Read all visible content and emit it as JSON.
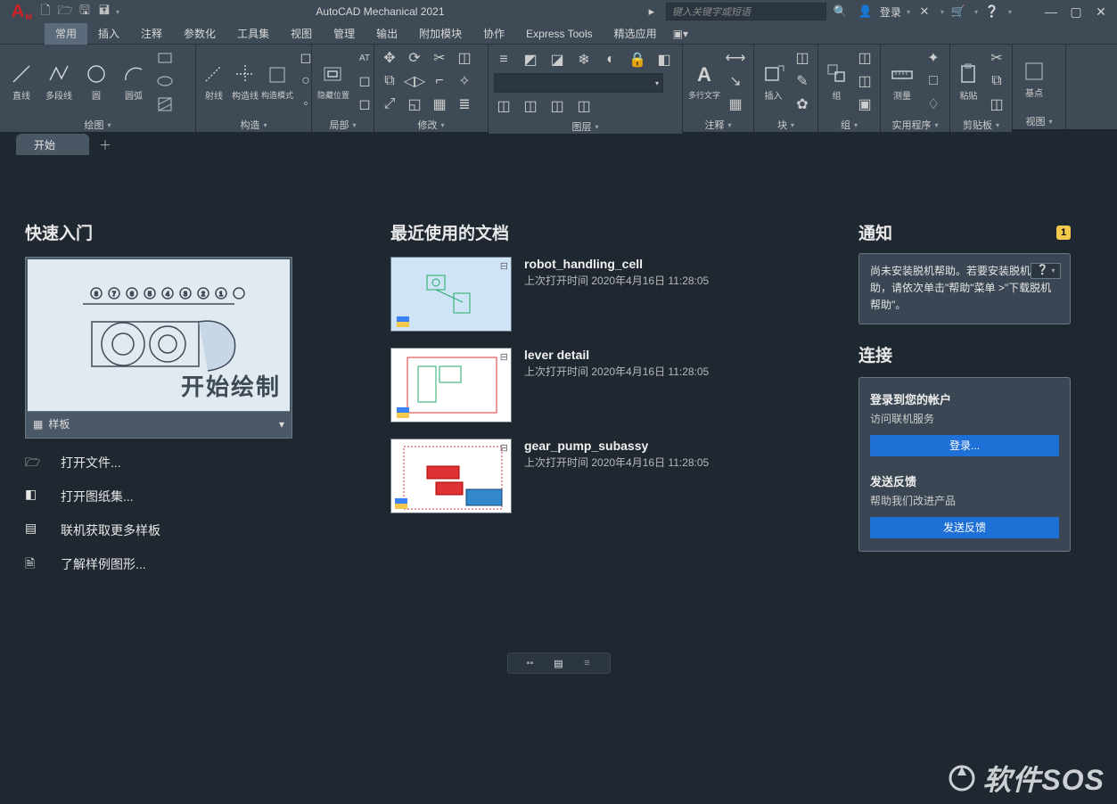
{
  "app": {
    "title": "AutoCAD Mechanical 2021",
    "logo": "A",
    "logo_sub": "M"
  },
  "search": {
    "placeholder": "键入关键字或短语",
    "login": "登录"
  },
  "ribbon_tabs": [
    "常用",
    "插入",
    "注释",
    "参数化",
    "工具集",
    "视图",
    "管理",
    "输出",
    "附加模块",
    "协作",
    "Express Tools",
    "精选应用"
  ],
  "panels": {
    "draw": {
      "title": "绘图",
      "tools": [
        "直线",
        "多段线",
        "圆",
        "圆弧"
      ]
    },
    "construct": {
      "title": "构造",
      "tools": [
        "射线",
        "构造线",
        "构造模式"
      ]
    },
    "visibility": {
      "title": "局部",
      "tool": "隐藏位置"
    },
    "modify": {
      "title": "修改"
    },
    "layer": {
      "title": "图层"
    },
    "text": {
      "title": "注释",
      "tool": "多行文字"
    },
    "block": {
      "title": "块",
      "tool": "插入"
    },
    "group": {
      "title": "组",
      "tool": "组"
    },
    "util": {
      "title": "实用程序",
      "tool": "测量"
    },
    "clip": {
      "title": "剪贴板",
      "tool": "粘贴"
    },
    "view": {
      "title": "视图",
      "tool": "基点"
    }
  },
  "doc_tab": "开始",
  "quickstart": {
    "title": "快速入门",
    "overlay": "开始绘制",
    "template": "样板",
    "links": [
      "打开文件...",
      "打开图纸集...",
      "联机获取更多样板",
      "了解样例图形..."
    ]
  },
  "recent": {
    "title": "最近使用的文档",
    "time_prefix": "上次打开时间",
    "timestamp": "2020年4月16日 11:28:05",
    "items": [
      {
        "name": "robot_handling_cell"
      },
      {
        "name": "lever detail"
      },
      {
        "name": "gear_pump_subassy"
      }
    ]
  },
  "sidepanel": {
    "notif_title": "通知",
    "notif_count": "1",
    "notif_text": "尚未安装脱机帮助。若要安装脱机帮助，请依次单击\"帮助\"菜单 >\"下载脱机帮助\"。",
    "connect_title": "连接",
    "signin_title": "登录到您的帐户",
    "signin_sub": "访问联机服务",
    "signin_btn": "登录...",
    "feedback_title": "发送反馈",
    "feedback_sub": "帮助我们改进产品",
    "feedback_btn": "发送反馈"
  },
  "watermark": "软件SOS"
}
